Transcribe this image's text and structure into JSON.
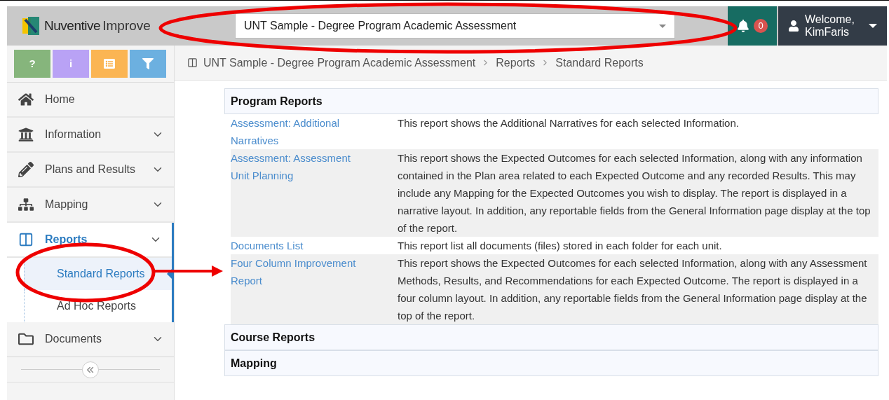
{
  "logo": {
    "brand": "Nuventive",
    "product": "Improve"
  },
  "project_select": {
    "value": "UNT Sample - Degree Program Academic Assessment"
  },
  "notifications": {
    "count": "0"
  },
  "user": {
    "greeting": "Welcome,",
    "name": "KimFaris"
  },
  "toolbar": [
    {
      "kind": "text",
      "label": "?",
      "color": "#86b57c"
    },
    {
      "kind": "text",
      "label": "i",
      "color": "#b9a2f5"
    },
    {
      "kind": "list",
      "color": "#fbb553"
    },
    {
      "kind": "filter",
      "color": "#6cb0e0"
    }
  ],
  "sidebar": {
    "items": [
      {
        "kind": "home",
        "label": "Home",
        "selected": false
      },
      {
        "kind": "information",
        "label": "Information",
        "selected": false
      },
      {
        "kind": "plans",
        "label": "Plans and Results",
        "selected": false
      },
      {
        "kind": "mapping",
        "label": "Mapping",
        "selected": false
      },
      {
        "kind": "reports",
        "label": "Reports",
        "selected": true,
        "children": [
          {
            "label": "Standard Reports",
            "selected": true
          },
          {
            "label": "Ad Hoc Reports",
            "selected": false
          }
        ]
      },
      {
        "kind": "documents",
        "label": "Documents",
        "selected": false
      }
    ]
  },
  "breadcrumb": [
    "UNT Sample - Degree Program Academic Assessment",
    "Reports",
    "Standard Reports"
  ],
  "sections": [
    {
      "title": "Program Reports",
      "rows": [
        {
          "name": "Assessment: Additional Narratives",
          "description": "This report shows the Additional Narratives for each selected Information."
        },
        {
          "name": "Assessment: Assessment Unit Planning",
          "description": "This report shows the Expected Outcomes for each selected Information, along with any information contained in the Plan area related to each Expected Outcome and any recorded Results. This may include any Mapping for the Expected Outcomes you wish to display. The report is displayed in a narrative layout. In addition, any reportable fields from the General Information page display at the top of the report."
        },
        {
          "name": "Documents List",
          "description": "This report list all documents (files) stored in each folder for each unit."
        },
        {
          "name": "Four Column Improvement Report",
          "description": "This report shows the Expected Outcomes for each selected Information, along with any Assessment Methods, Results, and Recommendations for each Expected Outcome. The report is displayed in a four column layout. In addition, any reportable fields from the General Information page display at the top of the report."
        }
      ]
    },
    {
      "title": "Course Reports"
    },
    {
      "title": "Mapping"
    }
  ]
}
